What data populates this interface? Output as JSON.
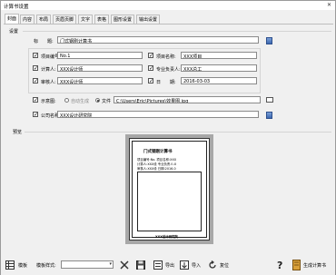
{
  "window": {
    "title": "计算书设置"
  },
  "tabs": [
    {
      "label": "封面",
      "active": true
    },
    {
      "label": "内容"
    },
    {
      "label": "布局"
    },
    {
      "label": "页眉页脚"
    },
    {
      "label": "文字"
    },
    {
      "label": "表格"
    },
    {
      "label": "图形设置"
    },
    {
      "label": "输出设置"
    }
  ],
  "settings": {
    "group_label": "设置",
    "title_label": "标　　题:",
    "title_value": "门式钢刚计算书",
    "project_no_label": "项目编号:",
    "project_no_value": "No.1",
    "project_name_label": "项目名称:",
    "project_name_value": "XXX项目",
    "calculator_label": "计算人:",
    "calculator_value": "XXX设计师",
    "manager_label": "专业负责人:",
    "manager_value": "XXX总工",
    "reviewer_label": "审核人:",
    "reviewer_value": "XXX设计师",
    "date_label": "日　　期:",
    "date_value": "2016-03-03",
    "diagram_label": "示意图:",
    "auto_gen_label": "自动生成",
    "file_label": "文件",
    "file_path": "C:\\Users\\Eric\\Pictures\\效果图.jpg",
    "company_label": "公司名称:",
    "company_value": "XXX设计研究院"
  },
  "preview": {
    "label": "预览",
    "doc_title": "门式钢刚计算书",
    "lines": [
      "项目编号:No.  项目名称:XXX",
      "计算人:XXX设  专业负责人:X",
      "审核人:XXX设  日期:2016-0"
    ],
    "footer": "XXX设计研究院"
  },
  "toolbar": {
    "template_label": "模板",
    "template_style_label": "模板样式:",
    "template_style_value": "",
    "export_label": "导出",
    "import_label": "导入",
    "reset_label": "复位",
    "generate_label": "生成计算书"
  }
}
